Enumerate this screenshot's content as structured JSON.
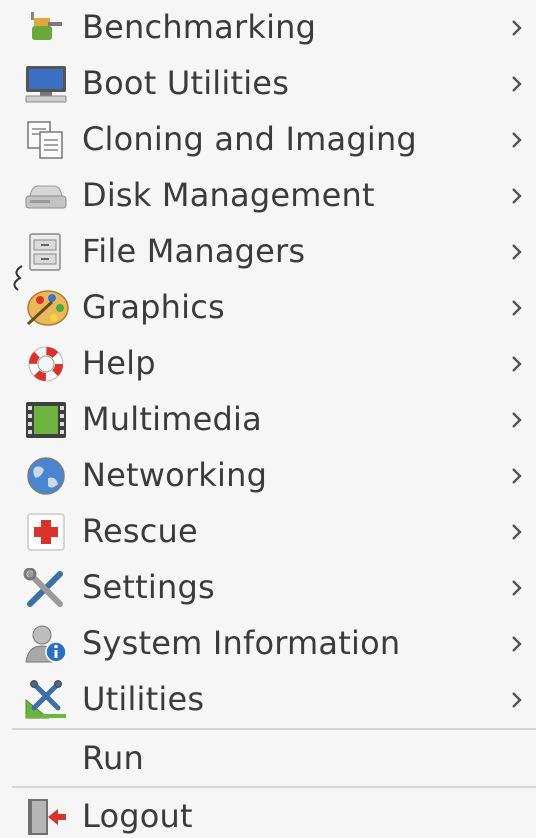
{
  "menu": {
    "items": [
      {
        "label": "Benchmarking",
        "icon": "benchmark-icon",
        "submenu": true
      },
      {
        "label": "Boot Utilities",
        "icon": "monitor-icon",
        "submenu": true
      },
      {
        "label": "Cloning and Imaging",
        "icon": "clone-icon",
        "submenu": true
      },
      {
        "label": "Disk Management",
        "icon": "disk-icon",
        "submenu": true
      },
      {
        "label": "File Managers",
        "icon": "file-cabinet-icon",
        "submenu": true
      },
      {
        "label": "Graphics",
        "icon": "palette-icon",
        "submenu": true
      },
      {
        "label": "Help",
        "icon": "lifebuoy-icon",
        "submenu": true
      },
      {
        "label": "Multimedia",
        "icon": "film-icon",
        "submenu": true
      },
      {
        "label": "Networking",
        "icon": "globe-icon",
        "submenu": true
      },
      {
        "label": "Rescue",
        "icon": "red-cross-icon",
        "submenu": true
      },
      {
        "label": "Settings",
        "icon": "tools-icon",
        "submenu": true
      },
      {
        "label": "System Information",
        "icon": "user-info-icon",
        "submenu": true
      },
      {
        "label": "Utilities",
        "icon": "utilities-icon",
        "submenu": true
      }
    ],
    "run_label": "Run",
    "logout_label": "Logout",
    "logout_icon": "logout-icon",
    "chevron_icon": "chevron-right-icon"
  }
}
